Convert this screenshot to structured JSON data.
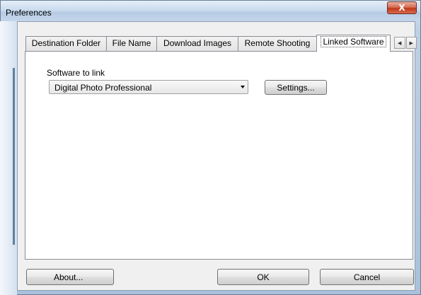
{
  "window": {
    "title": "Preferences",
    "close_glyph": "X"
  },
  "tabs": [
    {
      "label": "Destination Folder",
      "active": false
    },
    {
      "label": "File Name",
      "active": false
    },
    {
      "label": "Download Images",
      "active": false
    },
    {
      "label": "Remote Shooting",
      "active": false
    },
    {
      "label": "Linked Software",
      "active": true
    }
  ],
  "tab_scroll": {
    "left_icon": "scroll-left-icon",
    "right_icon": "scroll-right-icon",
    "left_glyph": "◀",
    "right_glyph": "▶"
  },
  "linked_software": {
    "label": "Software to link",
    "selected": "Digital Photo Professional",
    "settings_label": "Settings..."
  },
  "footer": {
    "about_label": "About...",
    "ok_label": "OK",
    "cancel_label": "Cancel"
  }
}
